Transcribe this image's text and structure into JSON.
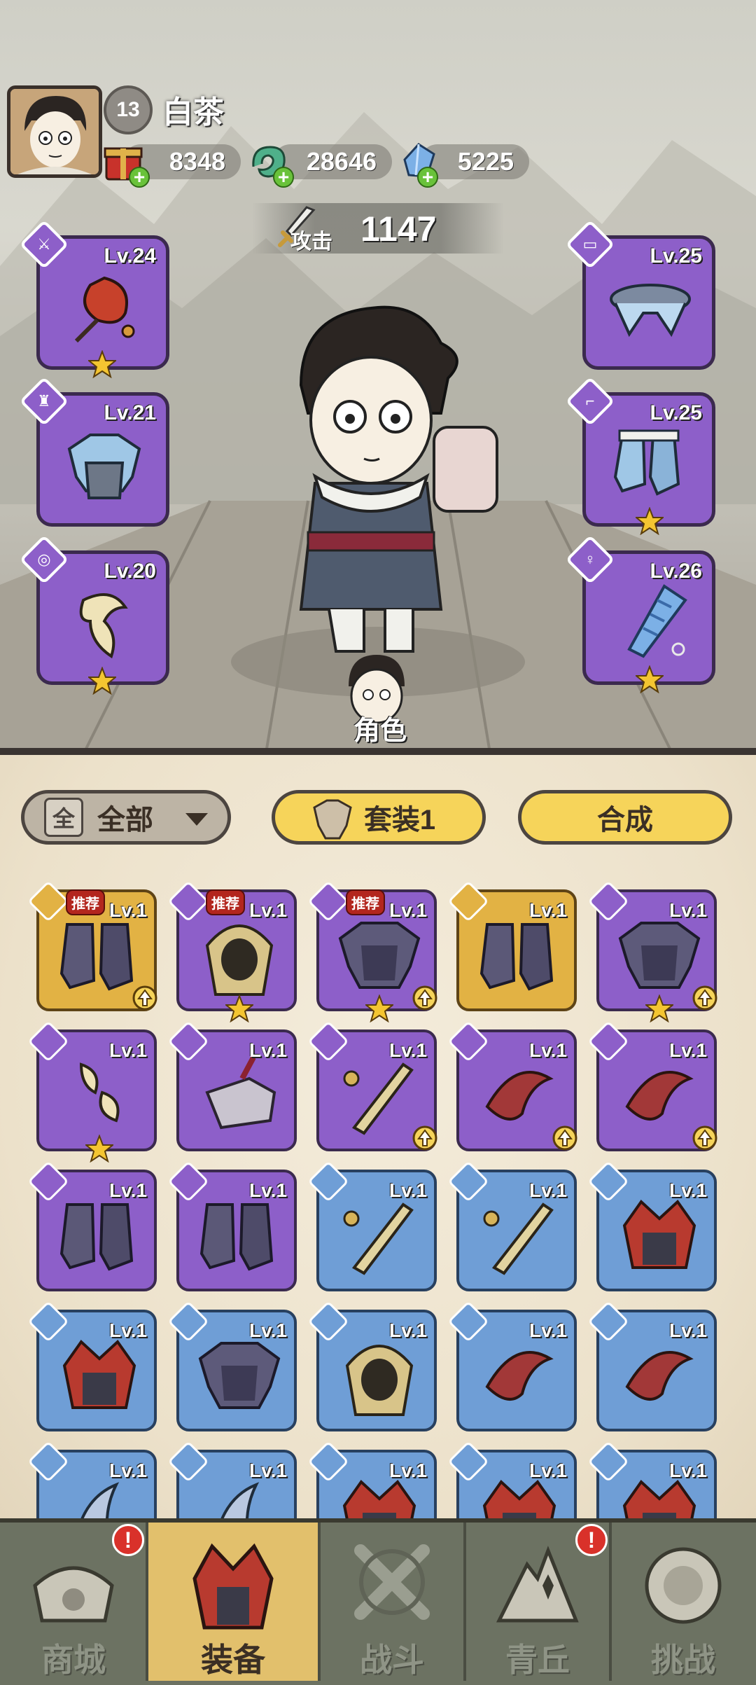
{
  "player": {
    "level": "13",
    "name": "白茶"
  },
  "currencies": [
    {
      "icon": "gift-box-icon",
      "value": "8348"
    },
    {
      "icon": "jade-dragon-icon",
      "value": "28646"
    },
    {
      "icon": "crystal-icon",
      "value": "5225"
    }
  ],
  "attack": {
    "label": "攻击",
    "value": "1147"
  },
  "equipped": {
    "left": [
      {
        "type": "weapon",
        "level": "Lv.24",
        "stars": 1
      },
      {
        "type": "armor",
        "level": "Lv.21",
        "stars": 0
      },
      {
        "type": "accessory",
        "level": "Lv.20",
        "stars": 1
      }
    ],
    "right": [
      {
        "type": "belt",
        "level": "Lv.25",
        "stars": 0
      },
      {
        "type": "boots",
        "level": "Lv.25",
        "stars": 1
      },
      {
        "type": "pendant",
        "level": "Lv.26",
        "stars": 1
      }
    ]
  },
  "role_label": "角色",
  "toolbar": {
    "filter_badge": "全",
    "filter_label": "全部",
    "set_label": "套装1",
    "merge_label": "合成"
  },
  "inventory": {
    "recommend_label": "推荐",
    "rows": [
      [
        {
          "rarity": "gold",
          "level": "Lv.1",
          "rec": true,
          "star": false,
          "up": true
        },
        {
          "rarity": "purple",
          "level": "Lv.1",
          "rec": true,
          "star": true,
          "up": false
        },
        {
          "rarity": "purple",
          "level": "Lv.1",
          "rec": true,
          "star": true,
          "up": true
        },
        {
          "rarity": "gold",
          "level": "Lv.1",
          "rec": false,
          "star": false,
          "up": false
        },
        {
          "rarity": "purple",
          "level": "Lv.1",
          "rec": false,
          "star": true,
          "up": true
        }
      ],
      [
        {
          "rarity": "purple",
          "level": "Lv.1",
          "rec": false,
          "star": true,
          "up": false
        },
        {
          "rarity": "purple",
          "level": "Lv.1",
          "rec": false,
          "star": false,
          "up": false
        },
        {
          "rarity": "purple",
          "level": "Lv.1",
          "rec": false,
          "star": false,
          "up": true
        },
        {
          "rarity": "purple",
          "level": "Lv.1",
          "rec": false,
          "star": false,
          "up": true
        },
        {
          "rarity": "purple",
          "level": "Lv.1",
          "rec": false,
          "star": false,
          "up": true
        }
      ],
      [
        {
          "rarity": "purple",
          "level": "Lv.1"
        },
        {
          "rarity": "purple",
          "level": "Lv.1"
        },
        {
          "rarity": "blue",
          "level": "Lv.1"
        },
        {
          "rarity": "blue",
          "level": "Lv.1"
        },
        {
          "rarity": "blue",
          "level": "Lv.1"
        }
      ],
      [
        {
          "rarity": "blue",
          "level": "Lv.1"
        },
        {
          "rarity": "blue",
          "level": "Lv.1"
        },
        {
          "rarity": "blue",
          "level": "Lv.1"
        },
        {
          "rarity": "blue",
          "level": "Lv.1"
        },
        {
          "rarity": "blue",
          "level": "Lv.1"
        }
      ],
      [
        {
          "rarity": "blue",
          "level": "Lv.1"
        },
        {
          "rarity": "blue",
          "level": "Lv.1"
        },
        {
          "rarity": "blue",
          "level": "Lv.1"
        },
        {
          "rarity": "blue",
          "level": "Lv.1"
        },
        {
          "rarity": "blue",
          "level": "Lv.1"
        }
      ]
    ]
  },
  "nav": [
    {
      "label": "商城",
      "icon": "shop-icon",
      "active": false,
      "alert": "!"
    },
    {
      "label": "装备",
      "icon": "equipment-helmet-icon",
      "active": true,
      "alert": ""
    },
    {
      "label": "战斗",
      "icon": "crossed-swords-icon",
      "active": false,
      "alert": ""
    },
    {
      "label": "青丘",
      "icon": "mountain-icon",
      "active": false,
      "alert": "!"
    },
    {
      "label": "挑战",
      "icon": "challenge-icon",
      "active": false,
      "alert": ""
    }
  ],
  "colors": {
    "purple": "#8d5fc9",
    "gold": "#e2b244",
    "blue": "#6f9ed6",
    "button_yellow": "#f6d45a",
    "nav_active": "#e2c06c"
  }
}
